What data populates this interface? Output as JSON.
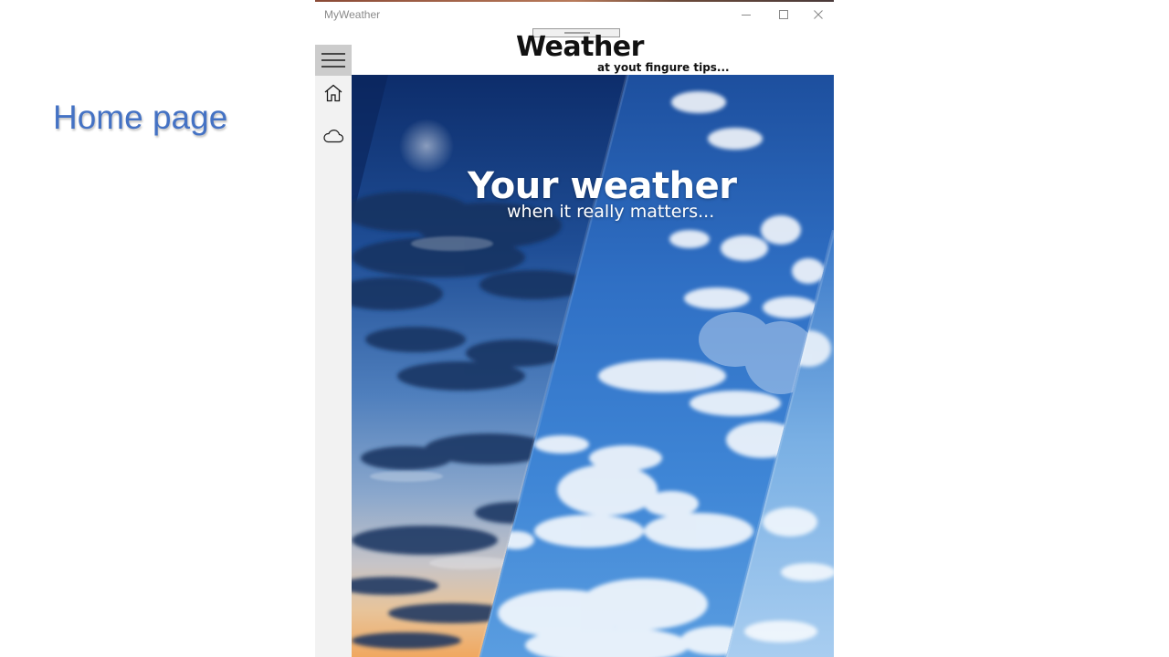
{
  "slide": {
    "caption": "Home page",
    "caption_color": "#4472c4"
  },
  "window": {
    "title": "MyWeather",
    "controls": [
      "minimize-icon",
      "maximize-icon",
      "close-icon"
    ]
  },
  "header": {
    "brand_title": "Weather",
    "brand_tagline": "at yout fingure tips..."
  },
  "nav": {
    "items": [
      {
        "name": "menu",
        "icon": "hamburger-menu-icon",
        "selected": true
      },
      {
        "name": "home",
        "icon": "home-icon",
        "selected": false
      },
      {
        "name": "weather",
        "icon": "cloud-icon",
        "selected": false
      }
    ],
    "selected_background": "#cccccc",
    "rail_background": "#f2f2f2"
  },
  "hero": {
    "headline": "Your weather",
    "subline": "when it really matters...",
    "panels": [
      "night-sky",
      "day-sky",
      "bright-sky"
    ]
  }
}
